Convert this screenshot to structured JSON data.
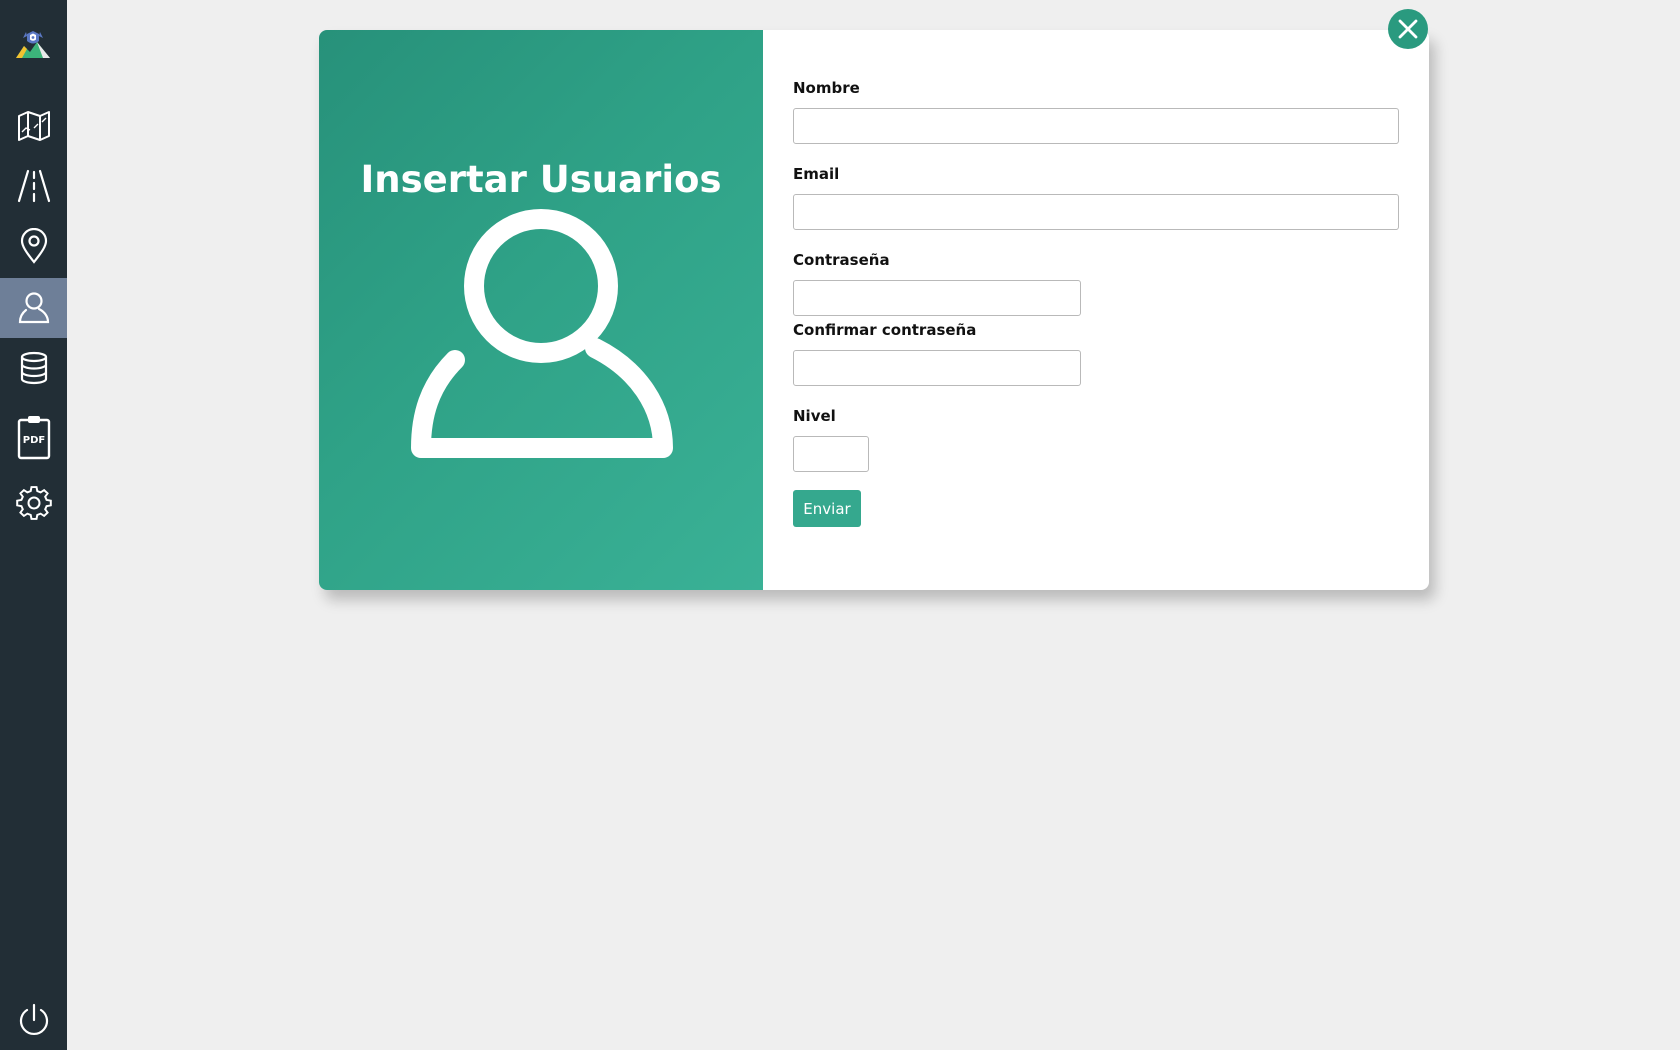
{
  "sidebar": {
    "items": [
      {
        "icon": "map-icon",
        "active": false
      },
      {
        "icon": "road-icon",
        "active": false
      },
      {
        "icon": "location-pin-icon",
        "active": false
      },
      {
        "icon": "user-icon",
        "active": true
      },
      {
        "icon": "database-icon",
        "active": false
      },
      {
        "icon": "pdf-icon",
        "label": "PDF",
        "active": false
      },
      {
        "icon": "gear-icon",
        "active": false
      }
    ],
    "power_icon": "power-icon",
    "logo_icon": "app-logo-icon"
  },
  "modal": {
    "title": "Insertar Usuarios",
    "hero_icon": "user-icon",
    "close_icon": "close-icon",
    "fields": {
      "nombre": {
        "label": "Nombre",
        "value": "",
        "placeholder": ""
      },
      "email": {
        "label": "Email",
        "value": "",
        "placeholder": ""
      },
      "password": {
        "label": "Contraseña",
        "value": "",
        "placeholder": ""
      },
      "confirm_password": {
        "label": "Confirmar contraseña",
        "value": "",
        "placeholder": ""
      },
      "nivel": {
        "label": "Nivel",
        "value": "",
        "placeholder": ""
      }
    },
    "submit_label": "Enviar"
  },
  "colors": {
    "sidebar_bg": "#222e36",
    "sidebar_active": "#6e7f98",
    "accent": "#2fa287",
    "page_bg": "#efefef"
  }
}
